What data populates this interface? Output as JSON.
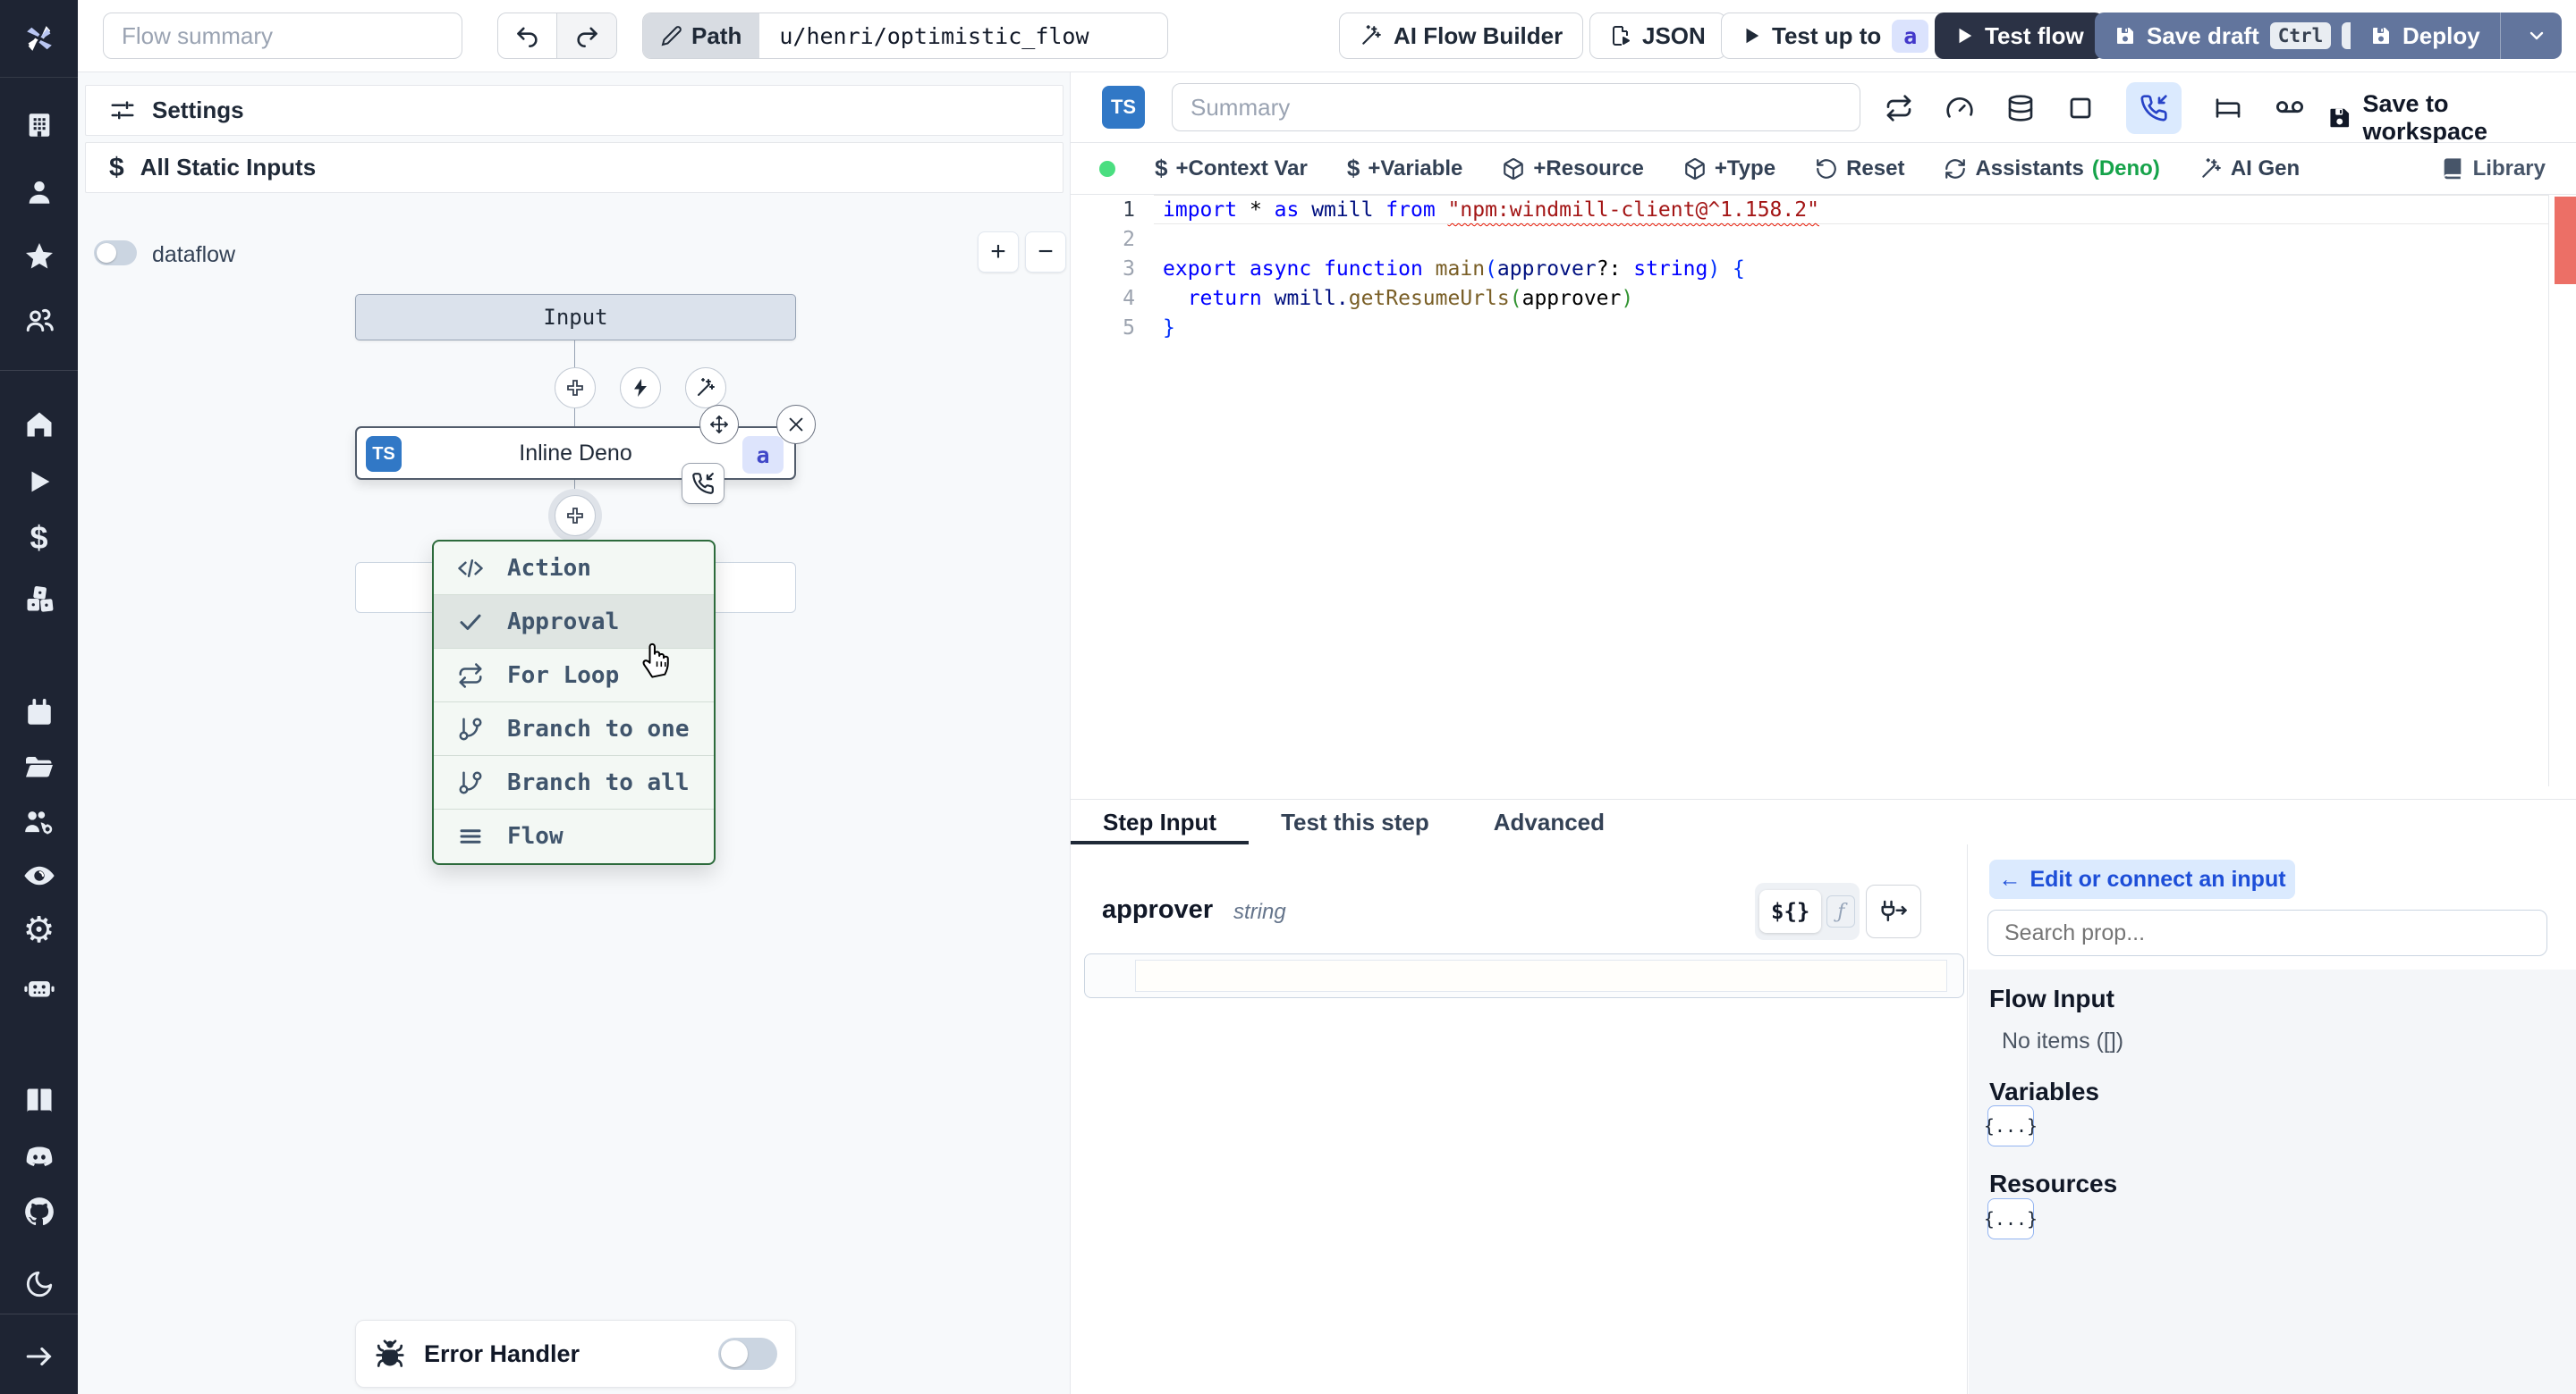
{
  "topbar": {
    "flow_summary_placeholder": "Flow summary",
    "path_label": "Path",
    "path_value": "u/henri/optimistic_flow",
    "ai_flow_builder": "AI Flow Builder",
    "json_label": "JSON",
    "test_up_to": "Test up to",
    "test_step_badge": "a",
    "test_flow": "Test flow",
    "save_draft": "Save draft",
    "kbd_ctrl": "Ctrl",
    "kbd_s": "S",
    "deploy": "Deploy"
  },
  "left": {
    "settings": "Settings",
    "all_static_inputs": "All Static Inputs",
    "dataflow": "dataflow",
    "zoom_in": "+",
    "zoom_out": "−",
    "error_handler": "Error Handler"
  },
  "graph": {
    "input_label": "Input",
    "node_lang": "TS",
    "node_label": "Inline Deno",
    "node_id": "a",
    "menu": {
      "action": "Action",
      "approval": "Approval",
      "for_loop": "For Loop",
      "branch_one": "Branch to one",
      "branch_all": "Branch to all",
      "flow": "Flow"
    }
  },
  "editor": {
    "lang": "TS",
    "summary_placeholder": "Summary",
    "save_to_workspace": "Save to workspace",
    "context_var": "+Context Var",
    "variable": "+Variable",
    "resource": "+Resource",
    "type": "+Type",
    "reset": "Reset",
    "assistants": "Assistants",
    "assistants_lang": "(Deno)",
    "ai_gen": "AI Gen",
    "library": "Library",
    "line_numbers": [
      "1",
      "2",
      "3",
      "4",
      "5"
    ],
    "code": {
      "l1": {
        "kw_import": "import",
        "star": " * ",
        "kw_as": "as",
        "var_wmill": " wmill ",
        "kw_from": "from",
        "space": " ",
        "string": "\"npm:windmill-client@^1.158.2\""
      },
      "l3": {
        "kw_export": "export ",
        "kw_async": "async ",
        "kw_function": "function ",
        "fn_main": "main",
        "p_open": "(",
        "arg": "approver",
        "punct": "?: ",
        "type": "string",
        "p_close": ")",
        "brace": " {"
      },
      "l4": {
        "kw_return": "  return ",
        "obj": "wmill.",
        "method": "getResumeUrls",
        "p_open": "(",
        "arg": "approver",
        "p_close": ")"
      },
      "l5": {
        "brace": "}"
      }
    }
  },
  "step": {
    "tab_step_input": "Step Input",
    "tab_test": "Test this step",
    "tab_advanced": "Advanced",
    "field_name": "approver",
    "field_type": "string",
    "toggle_template": "${}",
    "toggle_fn": "ƒ"
  },
  "props": {
    "edit_arrow": "←",
    "edit_or_connect": "Edit or connect an input",
    "search_placeholder": "Search prop...",
    "flow_input": "Flow Input",
    "no_items": "No items ([])",
    "variables": "Variables",
    "resources": "Resources",
    "object_chip": "{...}"
  }
}
